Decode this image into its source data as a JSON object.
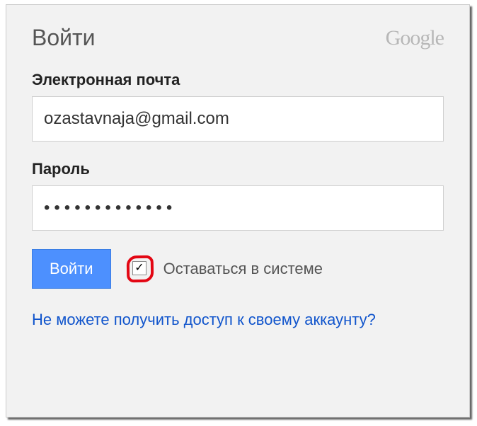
{
  "header": {
    "title": "Войти",
    "brand": "Google"
  },
  "email": {
    "label": "Электронная почта",
    "value": "ozastavnaja@gmail.com"
  },
  "password": {
    "label": "Пароль",
    "masked": "•••••••••••••"
  },
  "actions": {
    "signin_label": "Войти",
    "stay_signed_in_label": "Оставаться в системе",
    "stay_signed_in_checked": true
  },
  "help": {
    "cant_access_label": "Не можете получить доступ к своему аккаунту?"
  }
}
